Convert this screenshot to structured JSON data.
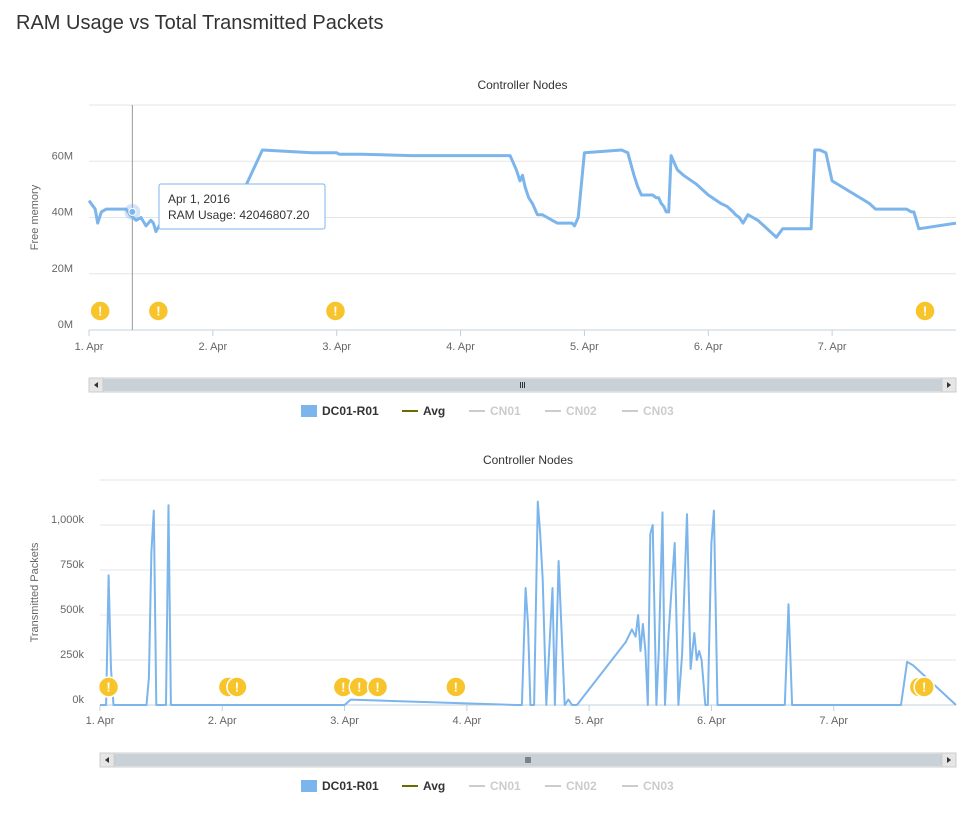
{
  "page": {
    "title": "RAM Usage vs Total Transmitted Packets"
  },
  "colors": {
    "series": "#7cb5ec",
    "avg": "#6b6b00",
    "disabled": "#cccccc",
    "alert": "#f7c52b",
    "grid": "#e6e6e6"
  },
  "icons": {
    "alert": "exclamation-alert-icon",
    "scroll_left": "arrow-left-icon",
    "scroll_right": "arrow-right-icon",
    "scroll_grip": "grip-icon"
  },
  "chart_data": [
    {
      "type": "line",
      "title": "Controller Nodes",
      "ylabel": "Free memory",
      "xlabel": "",
      "x_ticks": [
        "1. Apr",
        "2. Apr",
        "3. Apr",
        "4. Apr",
        "5. Apr",
        "6. Apr",
        "7. Apr"
      ],
      "x_range_days": [
        0,
        7
      ],
      "y_ticks": [
        "0M",
        "20M",
        "40M",
        "60M"
      ],
      "y_tick_values": [
        0,
        20000000,
        40000000,
        60000000
      ],
      "ylim": [
        0,
        80000000
      ],
      "grid": true,
      "legend_position": "bottom",
      "series": [
        {
          "name": "DC01-R01",
          "x": [
            0,
            0.05,
            0.07,
            0.1,
            0.14,
            0.3,
            0.33,
            0.38,
            0.42,
            0.46,
            0.5,
            0.52,
            0.54,
            0.58,
            0.62,
            0.66,
            0.7,
            0.8,
            0.9,
            1.0,
            1.2,
            1.4,
            1.6,
            1.8,
            1.98,
            2.0,
            2.02,
            2.2,
            2.6,
            3.0,
            3.2,
            3.4,
            3.42,
            3.45,
            3.48,
            3.5,
            3.52,
            3.55,
            3.58,
            3.62,
            3.66,
            3.7,
            3.74,
            3.78,
            3.82,
            3.86,
            3.9,
            3.92,
            3.95,
            4.0,
            4.3,
            4.35,
            4.4,
            4.43,
            4.46,
            4.48,
            4.5,
            4.55,
            4.58,
            4.6,
            4.62,
            4.64,
            4.66,
            4.68,
            4.7,
            4.75,
            4.8,
            4.9,
            5.0,
            5.1,
            5.15,
            5.2,
            5.22,
            5.25,
            5.28,
            5.32,
            5.36,
            5.4,
            5.45,
            5.5,
            5.55,
            5.6,
            5.75,
            5.8,
            5.83,
            5.86,
            5.9,
            5.95,
            6.0,
            6.3,
            6.35,
            6.6,
            6.64,
            6.66,
            6.7,
            7.0
          ],
          "values": [
            46,
            43,
            38,
            42,
            43,
            43,
            41,
            39,
            40,
            37,
            39,
            38,
            35,
            38,
            43,
            45,
            45,
            45,
            45,
            45,
            45,
            64,
            63.5,
            63,
            63,
            63,
            62.5,
            62.5,
            62,
            62,
            62,
            62,
            60,
            57,
            53,
            55,
            51,
            47,
            45,
            41,
            41,
            40,
            39,
            38,
            38,
            38,
            38,
            37,
            40,
            63,
            64,
            63,
            55,
            51,
            48,
            48,
            48,
            48,
            47,
            47,
            45,
            44,
            42,
            42,
            62,
            57,
            55,
            52,
            48,
            45,
            44,
            42,
            41,
            40,
            38,
            41,
            40,
            39,
            37,
            35,
            33,
            36,
            36,
            36,
            36,
            64,
            64,
            63,
            53,
            45,
            43,
            43,
            42,
            42,
            36,
            38
          ]
        },
        {
          "name": "Avg",
          "values": []
        },
        {
          "name": "CN01",
          "values": []
        },
        {
          "name": "CN02",
          "values": []
        },
        {
          "name": "CN03",
          "values": []
        }
      ],
      "alert_markers_days": [
        0.09,
        0.56,
        1.99,
        6.75
      ],
      "crosshair_day": 0.35,
      "tooltip": {
        "date": "Apr 1, 2016",
        "text": "RAM Usage: 42046807.20"
      }
    },
    {
      "type": "line",
      "title": "Controller Nodes",
      "ylabel": "Transmitted Packets",
      "xlabel": "",
      "x_ticks": [
        "1. Apr",
        "2. Apr",
        "3. Apr",
        "4. Apr",
        "5. Apr",
        "6. Apr",
        "7. Apr"
      ],
      "x_range_days": [
        0,
        7
      ],
      "y_ticks": [
        "0k",
        "250k",
        "500k",
        "750k",
        "1,000k"
      ],
      "y_tick_values": [
        0,
        250000,
        500000,
        750000,
        1000000
      ],
      "ylim": [
        0,
        1250000
      ],
      "grid": true,
      "legend_position": "bottom",
      "series": [
        {
          "name": "DC01-R01",
          "x": [
            0,
            0.05,
            0.07,
            0.09,
            0.11,
            0.13,
            0.2,
            0.38,
            0.4,
            0.42,
            0.44,
            0.46,
            0.48,
            0.5,
            0.52,
            0.54,
            0.56,
            0.58,
            0.62,
            2.0,
            2.05,
            3.4,
            3.45,
            3.48,
            3.5,
            3.52,
            3.55,
            3.58,
            3.6,
            3.62,
            3.65,
            3.7,
            3.72,
            3.75,
            3.8,
            3.83,
            3.86,
            3.88,
            3.9,
            4.3,
            4.35,
            4.38,
            4.4,
            4.42,
            4.44,
            4.46,
            4.48,
            4.5,
            4.52,
            4.55,
            4.57,
            4.6,
            4.62,
            4.65,
            4.7,
            4.73,
            4.76,
            4.8,
            4.83,
            4.86,
            4.88,
            4.9,
            4.92,
            4.95,
            4.97,
            5.0,
            5.02,
            5.05,
            5.1,
            5.15,
            5.2,
            5.25,
            5.3,
            5.35,
            5.4,
            5.6,
            5.63,
            5.66,
            5.7,
            6.0,
            6.55,
            6.6,
            6.65,
            7.0
          ],
          "values": [
            0,
            0,
            720,
            200,
            0,
            0,
            0,
            0,
            150,
            850,
            1080,
            0,
            0,
            0,
            0,
            0,
            1110,
            0,
            0,
            0,
            30,
            0,
            0,
            650,
            450,
            0,
            0,
            1130,
            950,
            700,
            0,
            650,
            0,
            800,
            0,
            30,
            0,
            0,
            0,
            350,
            420,
            380,
            500,
            300,
            450,
            300,
            0,
            950,
            1000,
            0,
            300,
            1070,
            0,
            400,
            900,
            0,
            280,
            1060,
            200,
            400,
            250,
            300,
            250,
            0,
            0,
            900,
            1080,
            0,
            0,
            0,
            0,
            0,
            0,
            0,
            0,
            0,
            560,
            0,
            0,
            0,
            0,
            240,
            220,
            0
          ]
        },
        {
          "name": "Avg",
          "values": []
        },
        {
          "name": "CN01",
          "values": []
        },
        {
          "name": "CN02",
          "values": []
        },
        {
          "name": "CN03",
          "values": []
        }
      ],
      "alert_markers_days": [
        0.07,
        1.05,
        1.12,
        1.99,
        2.12,
        2.27,
        2.91,
        6.7,
        6.74
      ]
    }
  ],
  "legends": [
    {
      "items": [
        "DC01-R01",
        "Avg",
        "CN01",
        "CN02",
        "CN03"
      ]
    },
    {
      "items": [
        "DC01-R01",
        "Avg",
        "CN01",
        "CN02",
        "CN03"
      ]
    }
  ]
}
